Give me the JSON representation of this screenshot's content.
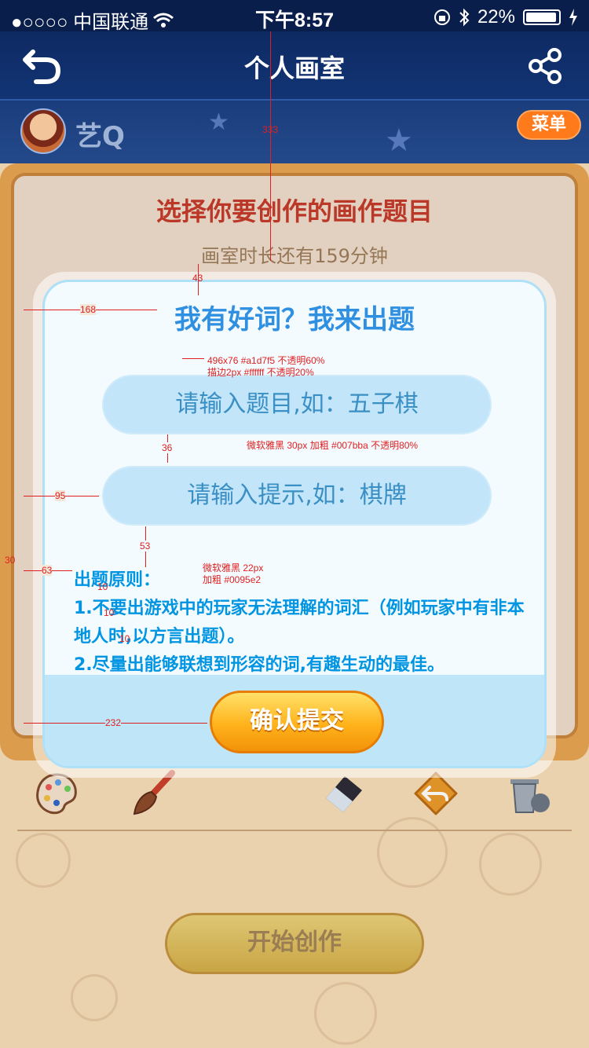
{
  "status_bar": {
    "carrier": "●○○○○ 中国联通",
    "time": "下午8:57",
    "battery": "22%"
  },
  "nav": {
    "title": "个人画室",
    "back_icon": "back-arrow-icon",
    "share_icon": "share-icon"
  },
  "user": {
    "name": "艺Q",
    "menu_label": "菜单"
  },
  "board": {
    "title": "选择你要创作的画作题目",
    "subtitle": "画室时长还有159分钟"
  },
  "dialog": {
    "title": "我有好词？我来出题",
    "topic_placeholder": "请输入题目,如：五子棋",
    "hint_placeholder": "请输入提示,如：棋牌",
    "rules_heading": "出题原则：",
    "rule_1": "1.不要出游戏中的玩家无法理解的词汇（例如玩家中有非本地人时,以方言出题）。",
    "rule_2": "2.尽量出能够联想到形容的词,有趣生动的最佳。",
    "confirm_label": "确认提交"
  },
  "start_button": "开始创作",
  "tools": [
    "palette-icon",
    "brush-icon",
    "eraser-icon",
    "undo-icon",
    "trash-icon"
  ],
  "annotations": {
    "dim_333": "333",
    "dim_43": "43",
    "dim_168": "168",
    "field_spec_1": "496x76  #a1d7f5 不透明60%",
    "field_spec_2": "描边2px #ffffff  不透明20%",
    "dim_36": "36",
    "font_spec_field": "微软雅黑 30px 加粗 #007bba 不透明80%",
    "dim_95": "95",
    "dim_53": "53",
    "dim_30": "30",
    "dim_63": "63",
    "font_spec_rules_1": "微软雅黑 22px",
    "font_spec_rules_2": "加粗 #0095e2",
    "dim_10a": "10",
    "dim_10b": "10",
    "dim_10c": "10",
    "dim_232": "232"
  },
  "colors": {
    "field_bg": "#a1d7f5",
    "rule_text": "#0095e2",
    "title_red": "#c33a2a",
    "spec": "#e02020"
  }
}
